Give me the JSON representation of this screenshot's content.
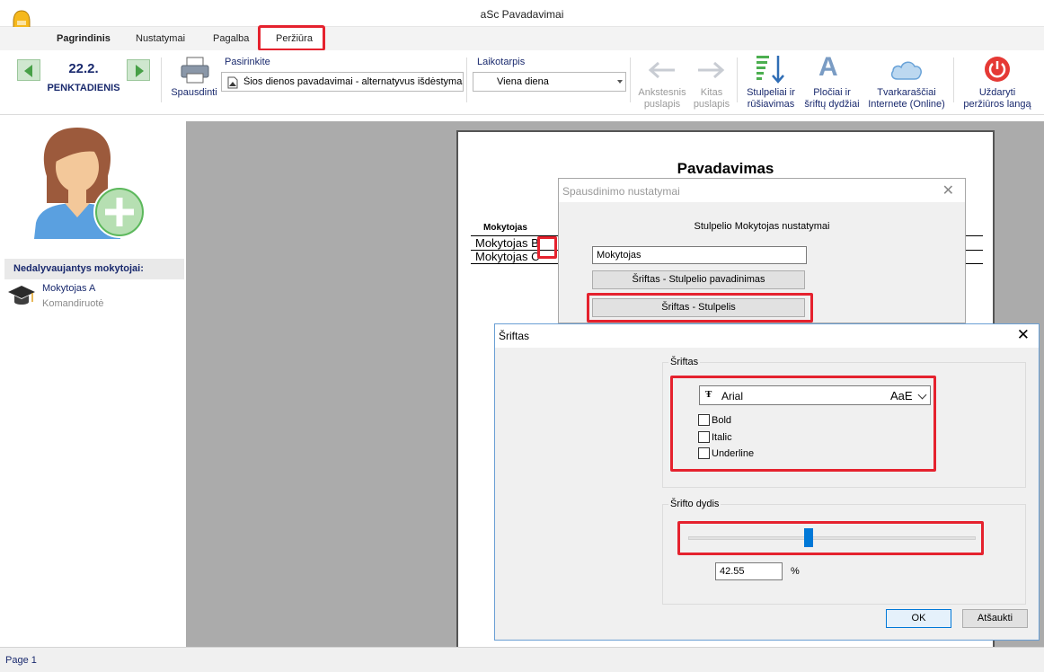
{
  "window": {
    "title": "aSc Pavadavimai"
  },
  "tabs": [
    "Pagrindinis",
    "Nustatymai",
    "Pagalba",
    "Peržiūra"
  ],
  "ribbon": {
    "date": "22.2.",
    "day": "PENKTADIENIS",
    "print_label": "Spausdinti",
    "choose_label": "Pasirinkite",
    "choose_value": "Šios dienos pavadavimai - alternatyvus išdėstymas",
    "period_label": "Laikotarpis",
    "period_value": "Viena diena",
    "prev_page_1": "Ankstesnis",
    "prev_page_2": "puslapis",
    "next_page_1": "Kitas",
    "next_page_2": "puslapis",
    "columns_1": "Stulpeliai ir",
    "columns_2": "rūšiavimas",
    "widths_1": "Pločiai ir",
    "widths_2": "šriftų dydžiai",
    "online_1": "Tvarkaraščiai",
    "online_2": "Internete (Online)",
    "close_1": "Uždaryti",
    "close_2": "peržiūros langą"
  },
  "sidebar": {
    "section_title": "Nedalyvaujantys mokytojai:",
    "teacher_name": "Mokytojas A",
    "teacher_status": "Komandiruotė"
  },
  "page": {
    "heading": "Pavadavimas",
    "column_header": "Mokytojas",
    "row1": "Mokytojas B",
    "row2": "Mokytojas C"
  },
  "print_dialog": {
    "title": "Spausdinimo nustatymai",
    "subtitle": "Stulpelio Mokytojas nustatymai",
    "name_value": "Mokytojas",
    "btn_header_font": "Šriftas - Stulpelio pavadinimas",
    "btn_column_font": "Šriftas - Stulpelis"
  },
  "font_dialog": {
    "title": "Šriftas",
    "group_font": "Šriftas",
    "font_name": "Arial",
    "font_preview": "AaE",
    "bold": "Bold",
    "italic": "Italic",
    "underline": "Underline",
    "group_size": "Šrifto dydis",
    "size_value": "42.55",
    "size_unit": "%",
    "size_slider_fraction": 0.42,
    "ok": "OK",
    "cancel": "Atšaukti"
  },
  "status": {
    "page": "Page 1"
  },
  "colors": {
    "accent_red": "#e5222e",
    "nav_green": "#47a047",
    "brand_navy": "#1a2a6e",
    "slider_blue": "#0078d7"
  }
}
